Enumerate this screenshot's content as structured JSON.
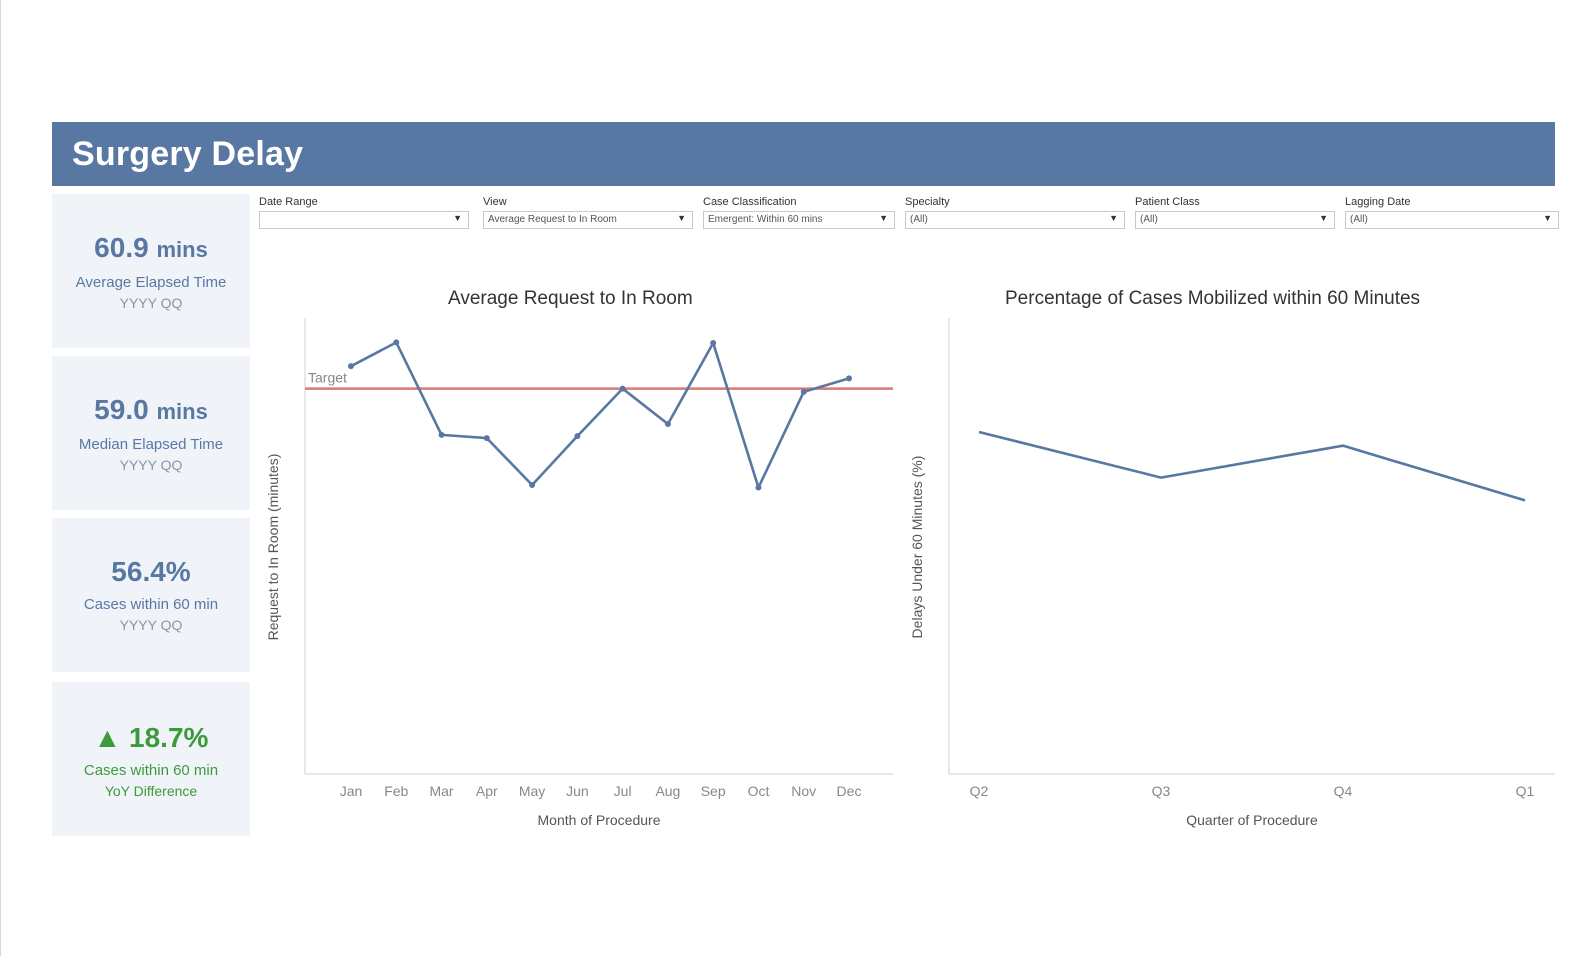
{
  "header": {
    "title": "Surgery Delay"
  },
  "kpis": [
    {
      "value": "60.9",
      "unit": "mins",
      "label": "Average Elapsed Time",
      "sub": "YYYY QQ"
    },
    {
      "value": "59.0",
      "unit": "mins",
      "label": "Median Elapsed Time",
      "sub": "YYYY QQ"
    },
    {
      "value": "56.4%",
      "unit": "",
      "label": "Cases within 60 min",
      "sub": "YYYY QQ"
    },
    {
      "value": "▲ 18.7%",
      "unit": "",
      "label": "Cases within 60 min",
      "sub": "YoY Difference"
    }
  ],
  "filters": [
    {
      "label": "Date Range",
      "value": ""
    },
    {
      "label": "View",
      "value": "Average Request to In Room"
    },
    {
      "label": "Case Classification",
      "value": "Emergent: Within 60 mins"
    },
    {
      "label": "Specialty",
      "value": "(All)"
    },
    {
      "label": "Patient Class",
      "value": "(All)"
    },
    {
      "label": "Lagging Date",
      "value": "(All)"
    }
  ],
  "colors": {
    "header": "#5878a3",
    "series": "#5878a3",
    "target": "#d67a74",
    "kpi_bg": "#f0f4f8",
    "positive": "#3c9a3c"
  },
  "chart_data": [
    {
      "type": "line",
      "title": "Average Request to In Room",
      "xlabel": "Month of Procedure",
      "ylabel": "Request to In Room (minutes)",
      "categories": [
        "Jan",
        "Feb",
        "Mar",
        "Apr",
        "May",
        "Jun",
        "Jul",
        "Aug",
        "Sep",
        "Oct",
        "Nov",
        "Dec"
      ],
      "values": [
        63.5,
        67.2,
        52.8,
        52.3,
        45.0,
        52.6,
        60.0,
        54.5,
        67.1,
        44.6,
        59.5,
        61.6
      ],
      "target": {
        "label": "Target",
        "value": 60
      },
      "ylim": [
        0,
        71
      ],
      "markers": true,
      "grid": false
    },
    {
      "type": "line",
      "title": "Percentage of Cases Mobilized within 60 Minutes",
      "xlabel": "Quarter of Procedure",
      "ylabel": "Delays Under 60 Minutes (%)",
      "categories": [
        "Q2",
        "Q3",
        "Q4",
        "Q1"
      ],
      "values": [
        75,
        65,
        72,
        60
      ],
      "ylim": [
        0,
        100
      ],
      "markers": false,
      "grid": false
    }
  ]
}
